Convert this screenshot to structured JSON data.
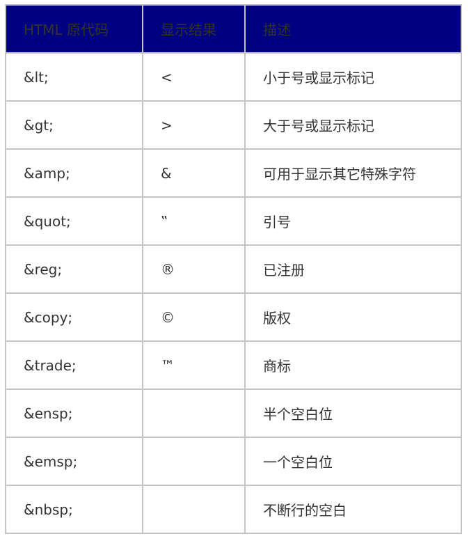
{
  "header": [
    "HTML 原代码",
    "显示结果",
    "描述"
  ],
  "header_bg": "#000080",
  "rows": [
    {
      "code": "&lt;",
      "result": "<",
      "desc": "小于号或显示标记"
    },
    {
      "code": "&gt;",
      "result": ">",
      "desc": "大于号或显示标记"
    },
    {
      "code": "&amp;",
      "result": "&",
      "desc": "可用于显示其它特殊字符"
    },
    {
      "code": "&quot;",
      "result": "‟",
      "desc": "引号"
    },
    {
      "code": "&reg;",
      "result": "®",
      "desc": "已注册"
    },
    {
      "code": "&copy;",
      "result": "©",
      "desc": "版权"
    },
    {
      "code": "&trade;",
      "result": "™",
      "desc": "商标"
    },
    {
      "code": "&ensp;",
      "result": "",
      "desc": "半个空白位"
    },
    {
      "code": "&emsp;",
      "result": "",
      "desc": "一个空白位"
    },
    {
      "code": "&nbsp;",
      "result": "",
      "desc": "不断行的空白"
    }
  ]
}
